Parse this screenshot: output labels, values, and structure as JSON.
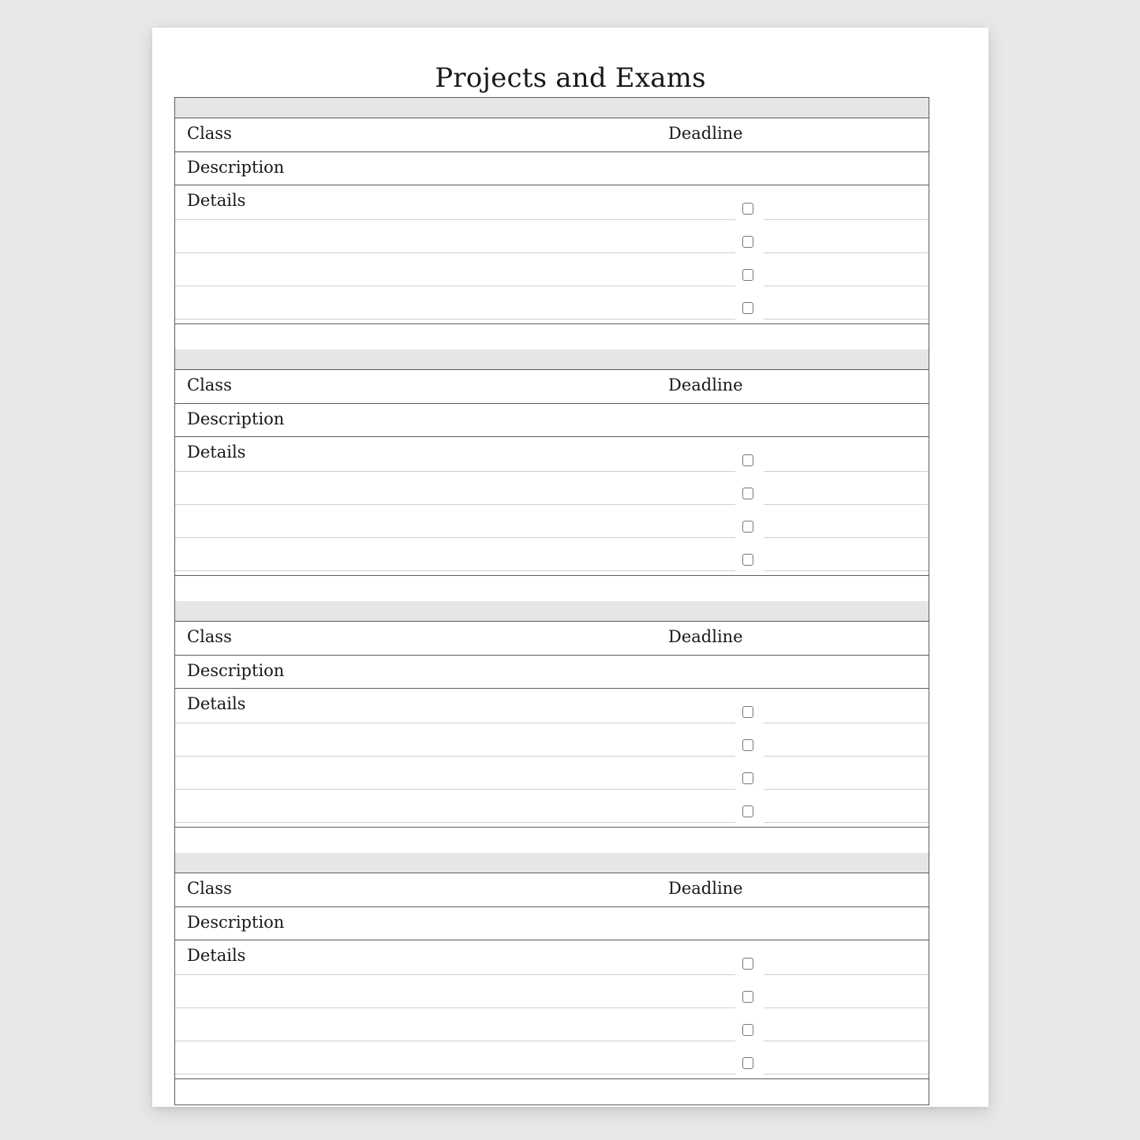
{
  "page": {
    "title": "Projects and Exams",
    "background_color": "#e8e8e8",
    "sheet_color": "#ffffff"
  },
  "styles": {
    "band_color": "#e6e6e6",
    "border_color": "#5a5a5c",
    "rule_color": "#cfcfcf",
    "checkbox_border_color": "#76767a",
    "text_color": "#17181a"
  },
  "labels": {
    "class": "Class",
    "deadline": "Deadline",
    "description": "Description",
    "details": "Details"
  },
  "entries": [
    {
      "class_label": "Class",
      "class_value": "",
      "deadline_label": "Deadline",
      "deadline_value": "",
      "description_label": "Description",
      "description_value": "",
      "details_label": "Details",
      "detail_lines": [
        "",
        "",
        "",
        ""
      ],
      "checkbox_items": [
        {
          "checked": false,
          "text": ""
        },
        {
          "checked": false,
          "text": ""
        },
        {
          "checked": false,
          "text": ""
        },
        {
          "checked": false,
          "text": ""
        }
      ]
    },
    {
      "class_label": "Class",
      "class_value": "",
      "deadline_label": "Deadline",
      "deadline_value": "",
      "description_label": "Description",
      "description_value": "",
      "details_label": "Details",
      "detail_lines": [
        "",
        "",
        "",
        ""
      ],
      "checkbox_items": [
        {
          "checked": false,
          "text": ""
        },
        {
          "checked": false,
          "text": ""
        },
        {
          "checked": false,
          "text": ""
        },
        {
          "checked": false,
          "text": ""
        }
      ]
    },
    {
      "class_label": "Class",
      "class_value": "",
      "deadline_label": "Deadline",
      "deadline_value": "",
      "description_label": "Description",
      "description_value": "",
      "details_label": "Details",
      "detail_lines": [
        "",
        "",
        "",
        ""
      ],
      "checkbox_items": [
        {
          "checked": false,
          "text": ""
        },
        {
          "checked": false,
          "text": ""
        },
        {
          "checked": false,
          "text": ""
        },
        {
          "checked": false,
          "text": ""
        }
      ]
    },
    {
      "class_label": "Class",
      "class_value": "",
      "deadline_label": "Deadline",
      "deadline_value": "",
      "description_label": "Description",
      "description_value": "",
      "details_label": "Details",
      "detail_lines": [
        "",
        "",
        "",
        ""
      ],
      "checkbox_items": [
        {
          "checked": false,
          "text": ""
        },
        {
          "checked": false,
          "text": ""
        },
        {
          "checked": false,
          "text": ""
        },
        {
          "checked": false,
          "text": ""
        }
      ]
    }
  ]
}
